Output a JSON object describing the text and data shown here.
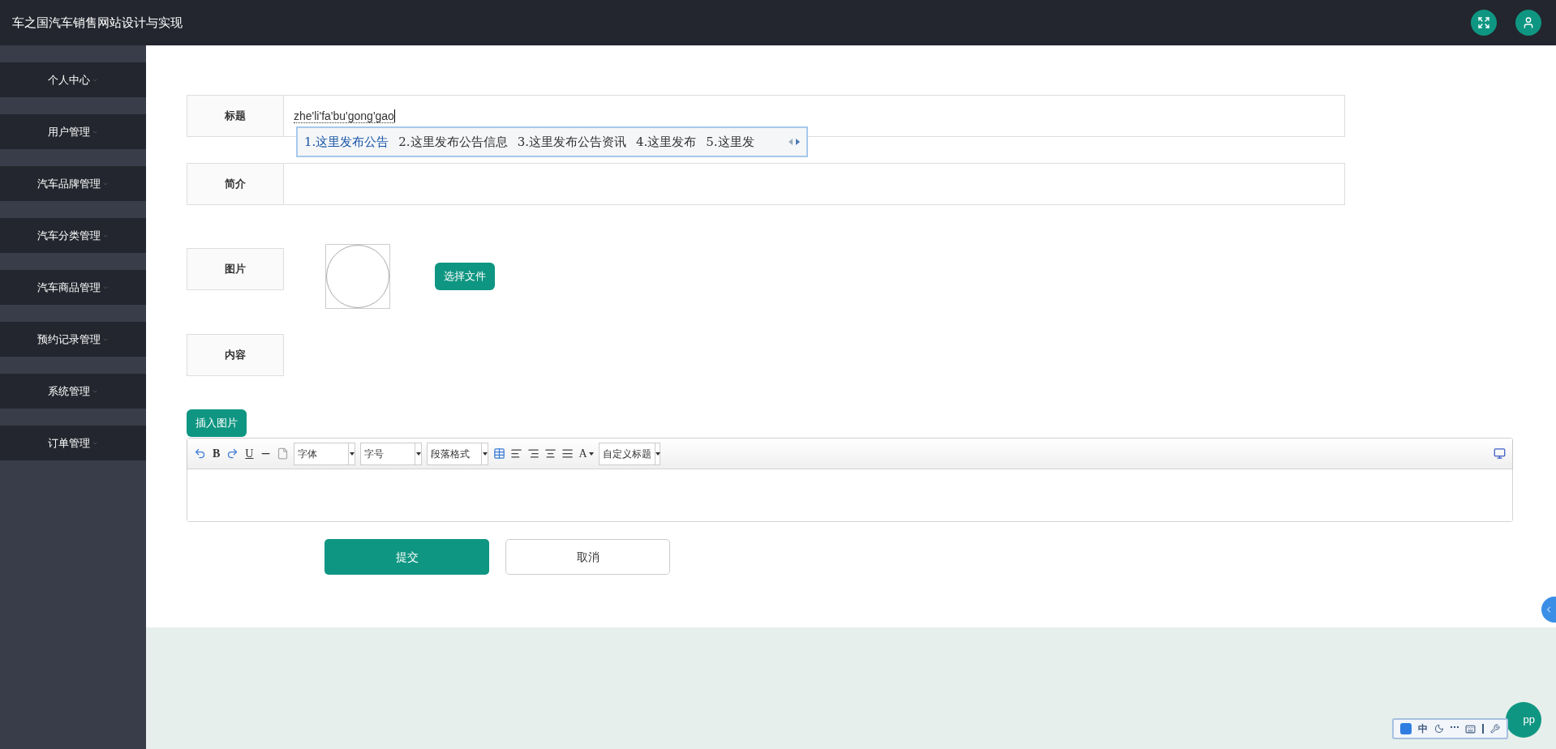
{
  "header": {
    "title": "车之国汽车销售网站设计与实现"
  },
  "sidebar": {
    "items": [
      {
        "label": "个人中心"
      },
      {
        "label": "用户管理"
      },
      {
        "label": "汽车品牌管理"
      },
      {
        "label": "汽车分类管理"
      },
      {
        "label": "汽车商品管理"
      },
      {
        "label": "预约记录管理"
      },
      {
        "label": "系统管理"
      },
      {
        "label": "订单管理"
      }
    ]
  },
  "form": {
    "title_label": "标题",
    "title_value": "zhe'li'fa'bu'gong'gao",
    "intro_label": "简介",
    "image_label": "图片",
    "choose_file": "选择文件",
    "content_label": "内容",
    "insert_image": "插入图片"
  },
  "ime": {
    "candidates": [
      {
        "text": "1.这里发布公告",
        "selected": true
      },
      {
        "text": "2.这里发布公告信息",
        "selected": false
      },
      {
        "text": "3.这里发布公告资讯",
        "selected": false
      },
      {
        "text": "4.这里发布",
        "selected": false
      },
      {
        "text": "5.这里发",
        "selected": false
      }
    ],
    "mode": "中"
  },
  "editor": {
    "bold": "B",
    "underline": "U",
    "selects": [
      "字体",
      "字号",
      "段落格式"
    ],
    "font_color": "A",
    "heading_select": "自定义标题"
  },
  "buttons": {
    "submit": "提交",
    "cancel": "取消"
  },
  "app_bubble": "pp"
}
